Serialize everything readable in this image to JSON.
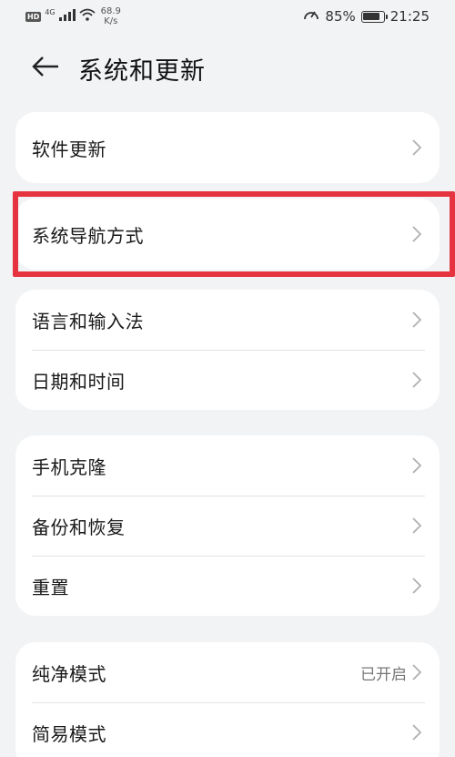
{
  "status_bar": {
    "hd": "HD",
    "network": "4G",
    "speed_value": "68.9",
    "speed_unit": "K/s",
    "battery": "85%",
    "battery_level": 0.85,
    "time": "21:25"
  },
  "header": {
    "title": "系统和更新"
  },
  "groups": [
    {
      "items": [
        {
          "label": "软件更新",
          "value": ""
        }
      ]
    },
    {
      "items": [
        {
          "label": "系统导航方式",
          "value": ""
        }
      ]
    },
    {
      "items": [
        {
          "label": "语言和输入法",
          "value": ""
        },
        {
          "label": "日期和时间",
          "value": ""
        }
      ]
    },
    {
      "items": [
        {
          "label": "手机克隆",
          "value": ""
        },
        {
          "label": "备份和恢复",
          "value": ""
        },
        {
          "label": "重置",
          "value": ""
        }
      ]
    },
    {
      "items": [
        {
          "label": "纯净模式",
          "value": "已开启"
        },
        {
          "label": "简易模式",
          "value": ""
        }
      ]
    }
  ],
  "colors": {
    "background": "#f1f3f5",
    "card": "#ffffff",
    "highlight_border": "#e5333f"
  }
}
